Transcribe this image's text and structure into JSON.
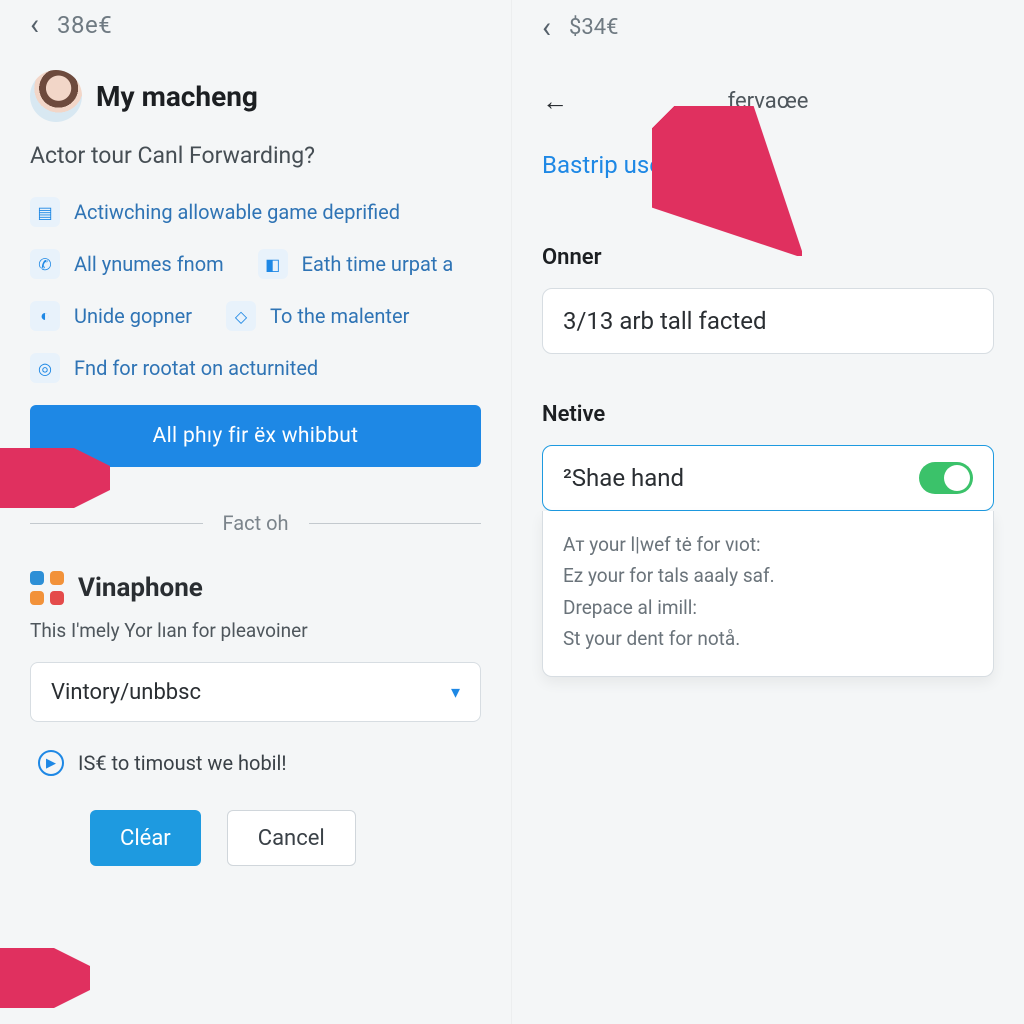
{
  "left": {
    "top_amount": "38e€",
    "profile_name": "My macheng",
    "question": "Actor tour Canl Forwarding?",
    "items": {
      "a": "Actiwching allowable game deprified",
      "b": "All ynumes fnom",
      "c": "Eath time urpat a",
      "d": "Unide gopner",
      "e": "To the malenter",
      "f": "Fnd for rootat on acturnited"
    },
    "big_button": "All phıy fir ëx whibbut",
    "divider_label": "Fact oh",
    "brand_name": "Vinaphone",
    "brand_sub": "This I'mely Yor lıan for pleavoiner",
    "select_value": "Vintory/unbbsc",
    "promo_text": "IS€ to timoust we hobil!",
    "clear_label": "Cléar",
    "cancel_label": "Cancel"
  },
  "right": {
    "top_amount": "$34€",
    "page_title": "fervaœe",
    "link_text": "Bastrip useêt writaby",
    "label_owner": "Onner",
    "owner_value": "3/13 arb tall facted",
    "label_native": "Netive",
    "native_value": "²Shae hand",
    "dropdown": {
      "l1": "Aт your l|wef tė for vıot:",
      "l2": "Ez your for tals aaaly saf.",
      "l3": "Drepace al imill:",
      "l4": "St your dent for notå."
    }
  }
}
